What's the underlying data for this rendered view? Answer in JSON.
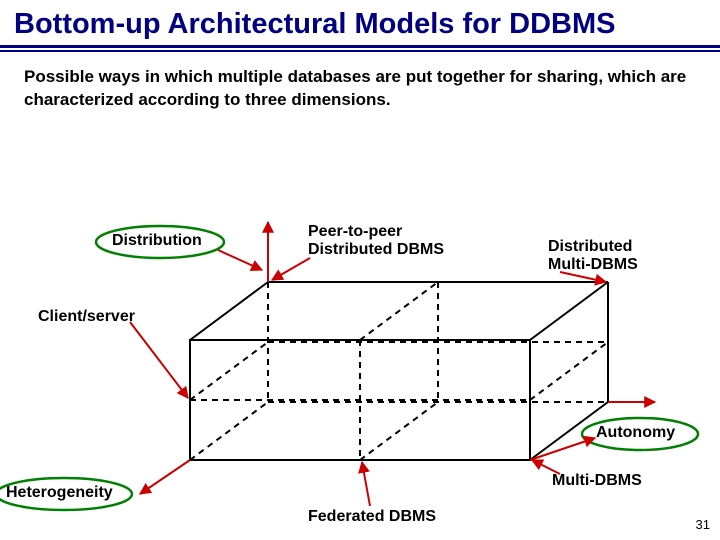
{
  "slide": {
    "title": "Bottom-up Architectural Models for DDBMS",
    "subtitle": "Possible ways in which multiple databases are put together for sharing, which are characterized according to three dimensions.",
    "page_number": "31"
  },
  "axes": {
    "distribution": "Distribution",
    "autonomy": "Autonomy",
    "heterogeneity": "Heterogeneity"
  },
  "labels": {
    "peer_to_peer_line1": "Peer-to-peer",
    "peer_to_peer_line2": "Distributed DBMS",
    "distributed_multi_line1": "Distributed",
    "distributed_multi_line2": "Multi-DBMS",
    "client_server": "Client/server",
    "multi_dbms": "Multi-DBMS",
    "federated_dbms": "Federated DBMS"
  },
  "chart_data": {
    "type": "diagram",
    "description": "3D cube representing architectural dimensions of DDBMS",
    "axes": [
      "Distribution",
      "Autonomy",
      "Heterogeneity"
    ],
    "labeled_points": [
      {
        "name": "Peer-to-peer Distributed DBMS",
        "position": "top-back-left"
      },
      {
        "name": "Distributed Multi-DBMS",
        "position": "top-back-right"
      },
      {
        "name": "Client/server",
        "position": "mid-front-left"
      },
      {
        "name": "Autonomy",
        "position": "axis-right"
      },
      {
        "name": "Multi-DBMS",
        "position": "front-right-bottom"
      },
      {
        "name": "Federated DBMS",
        "position": "front-mid-bottom"
      },
      {
        "name": "Heterogeneity",
        "position": "axis-front-left"
      }
    ]
  }
}
